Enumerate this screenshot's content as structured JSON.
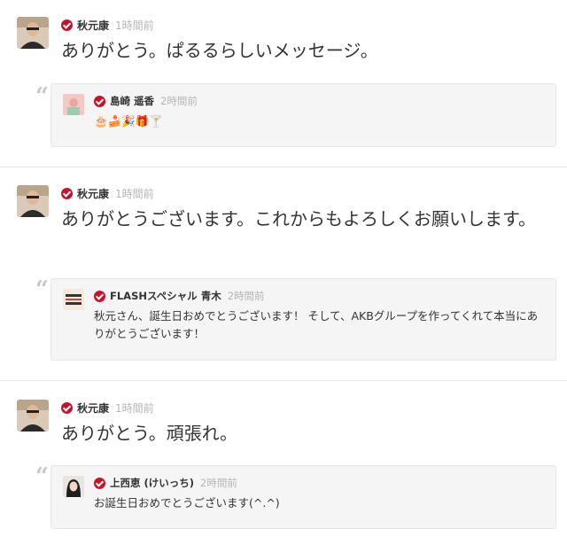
{
  "posts": [
    {
      "author": "秋元康",
      "time": "1時間前",
      "text": "ありがとう。ぱるるらしいメッセージ。",
      "quote": {
        "author": "島崎 遥香",
        "time": "2時間前",
        "text": "🎂🍰🎉🎁🍸",
        "avatar_color": "#f2c9c5"
      }
    },
    {
      "author": "秋元康",
      "time": "1時間前",
      "text": "ありがとうございます。これからもよろしくお願いします。",
      "quote": {
        "author": "FLASHスペシャル 青木",
        "time": "2時間前",
        "text": "秋元さん、誕生日おめでとうございます！ そして、AKBグループを作ってくれて本当にありがとうございます！",
        "avatar_color": "#f4eadc"
      }
    },
    {
      "author": "秋元康",
      "time": "1時間前",
      "text": "ありがとう。頑張れ。",
      "quote": {
        "author": "上西恵 (けいっち)",
        "time": "2時間前",
        "text": "お誕生日おめでとうございます(^.^)",
        "avatar_color": "#e9e4e2"
      }
    }
  ],
  "icons": {
    "verified": "verified-check-icon",
    "quote": "quote-icon"
  },
  "colors": {
    "verified": "#c4142b",
    "time": "#b5b5b5",
    "quote_bg": "#f5f5f5"
  }
}
